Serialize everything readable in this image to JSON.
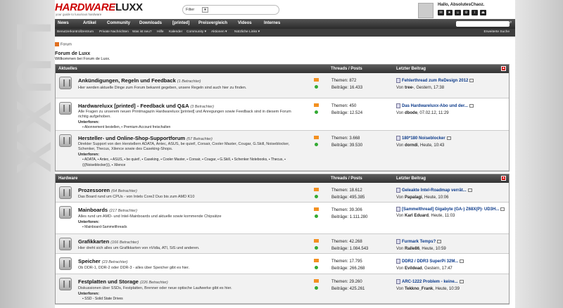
{
  "header": {
    "logo_part1": "HARDWARE",
    "logo_part2": "LUXX",
    "tagline": "your guide to luxurious hardware",
    "filter_label": "Filter",
    "greeting": "Hallo, AbsolutesChaoz."
  },
  "nav": {
    "items": [
      "News",
      "Artikel",
      "Community",
      "Downloads",
      "[printed]",
      "Preisvergleich",
      "Videos",
      "Internes"
    ],
    "advanced_search": "Erweiterte Suche"
  },
  "subnav": {
    "items": [
      "Benutzerkontrollzentrum",
      "Private Nachrichten",
      "Was ist neu?",
      "Hilfe",
      "Kalender",
      "Community ▾",
      "Aktionen ▾",
      "Nützliche Links ▾"
    ]
  },
  "breadcrumb": "Forum",
  "page": {
    "title": "Forum de Luxx",
    "welcome": "Willkommen bei Forum de Luxx."
  },
  "columns": {
    "threads": "Threads / Posts",
    "last": "Letzter Beitrag"
  },
  "categories": [
    {
      "name": "Aktuelles",
      "forums": [
        {
          "name": "Ankündigungen, Regeln und Feedback",
          "viewers": "(1 Betrachter)",
          "desc": "Hier werden aktuelle Dinge zum Forum bekannt gegeben, unsere Regeln sind auch hier zu finden.",
          "sub_heading": "",
          "subs": "",
          "threads": "Themen: 872",
          "posts": "Beiträge: 16.433",
          "last_title": "Fehlerthread zum ReDesign 2012",
          "last_by": "Von",
          "last_user": "tree-",
          "last_time": ", Gestern, 17:38"
        },
        {
          "name": "Hardwareluxx [printed] - Feedback und Q&A",
          "viewers": "(3 Betrachter)",
          "desc": "Alle Fragen zu unserem neuen Printmagazin Hardwareluxx [printed] und Anregungen sowie Feedback sind in diesem Forum richtig aufgehoben.",
          "sub_heading": "Unterforen:",
          "subs": "▪ Abonnement bestellen,   ▪ Premium-Account freischalten",
          "threads": "Themen: 450",
          "posts": "Beiträge: 12.524",
          "last_title": "Das Hardwareluxx-Abo und der...",
          "last_by": "Von",
          "last_user": "dbode",
          "last_time": ", 07.02.12, 11:29"
        },
        {
          "name": "Hersteller- und Online-Shop-Supportforum",
          "viewers": "(57 Betrachter)",
          "desc": "Direkter Support von den Herstellern ADATA, Antec, ASUS, be quiet!, Corsair, Cooler Master, Cougar, G.Skill, Noiseblocker, Schenker, Thecus, Xilence sowie des Caseking-Shops.",
          "sub_heading": "Unterforen:",
          "subs": "▪ ADATA,   ▪ Antec,   ▪ ASUS,   ▪ be quiet!,   ▪ Caseking,   ▪ Cooler Master,   ▪ Corsair,   ▪ Cougar,   ▪ G.Skill,   ▪ Schenker Notebooks,   ▪ Thecus,   ▪ (((Noiseblocker))),   ▪ Xilence",
          "threads": "Themen: 3.668",
          "posts": "Beiträge: 39.530",
          "last_title": "180*180 Noiseblocker",
          "last_by": "Von",
          "last_user": "dorndi",
          "last_time": ", Heute, 10:43"
        }
      ]
    },
    {
      "name": "Hardware",
      "forums": [
        {
          "name": "Prozessoren",
          "viewers": "(64 Betrachter)",
          "desc": "Das Board rund um CPUs - von Intels Core2 Duo bis zum AMD K10",
          "sub_heading": "",
          "subs": "",
          "threads": "Themen: 18.612",
          "posts": "Beiträge: 495.385",
          "last_title": "Geleakte Intel-Roadmap verrät...",
          "last_by": "Von",
          "last_user": "Papalagi",
          "last_time": ", Heute, 10:06"
        },
        {
          "name": "Mainboards",
          "viewers": "(217 Betrachter)",
          "desc": "Alles rund um AMD- und Intel-Mainboards und aktuelle sowie kommende Chipsätze",
          "sub_heading": "Unterforen:",
          "subs": "▪ Mainboard-Sammelthreads",
          "threads": "Themen: 39.306",
          "posts": "Beiträge: 1.111.280",
          "last_title": "[Sammelthread] Gigabyte (GA-) Z68X(P)- UD3H...",
          "last_by": "Von",
          "last_user": "Karl Eduard",
          "last_time": ", Heute, 11:03"
        },
        {
          "name": "Grafikkarten",
          "viewers": "(166 Betrachter)",
          "desc": "Hier dreht sich alles um Grafikkarten von nVidia, ATI, SiS und anderen.",
          "sub_heading": "",
          "subs": "",
          "threads": "Themen: 42.268",
          "posts": "Beiträge: 1.084.543",
          "last_title": "Furmark Temps?",
          "last_by": "Von",
          "last_user": "Ralle86",
          "last_time": ", Heute, 10:59"
        },
        {
          "name": "Speicher",
          "viewers": "(23 Betrachter)",
          "desc": "Ob DDR-1, DDR-2 oder DDR-3 - alles über Speicher gibt es hier.",
          "sub_heading": "",
          "subs": "",
          "threads": "Themen: 17.795",
          "posts": "Beiträge: 266.268",
          "last_title": "DDR2 / DDR3 SuperPi 32M...",
          "last_by": "Von",
          "last_user": "Evildead",
          "last_time": ", Gestern, 17:47"
        },
        {
          "name": "Festplatten und Storage",
          "viewers": "(226 Betrachter)",
          "desc": "Diskussionen über SSDs, Festplatten, Brenner oder neue optische Laufwerke gibt es hier.",
          "sub_heading": "Unterforen:",
          "subs": "▪ SSD - Solid State Drives",
          "threads": "Themen: 29.260",
          "posts": "Beiträge: 425.261",
          "last_title": "ARC-1222 Problem - keine...",
          "last_by": "Von",
          "last_user": "Tekkno_Frank",
          "last_time": ", Heute, 10:39"
        }
      ]
    }
  ]
}
